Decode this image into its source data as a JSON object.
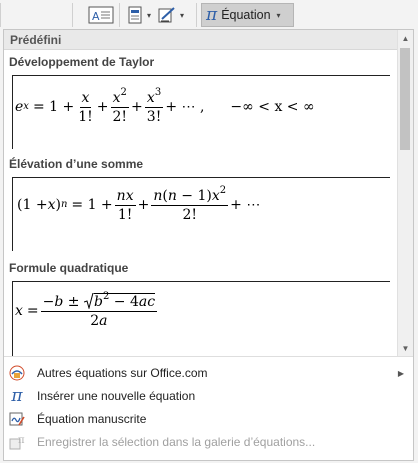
{
  "ribbon": {
    "equation_button": {
      "icon": "pi-icon",
      "label": "Équation"
    },
    "icons": [
      "text-box-icon",
      "quick-parts-icon",
      "signature-line-icon"
    ]
  },
  "gallery": {
    "category": "Prédéfini",
    "items": [
      {
        "title": "Développement de Taylor",
        "range": "−∞ < x < ∞"
      },
      {
        "title": "Élévation d’une somme"
      },
      {
        "title": "Formule quadratique"
      }
    ]
  },
  "menu": {
    "items": [
      {
        "label": "Autres équations sur Office.com",
        "icon": "office-equations-icon",
        "submenu": true,
        "enabled": true
      },
      {
        "label": "Insérer une nouvelle équation",
        "icon": "pi-icon",
        "enabled": true
      },
      {
        "label": "Équation manuscrite",
        "icon": "ink-equation-icon",
        "enabled": true
      },
      {
        "label": "Enregistrer la sélection dans la galerie d’équations...",
        "icon": "save-to-gallery-icon",
        "enabled": false
      }
    ]
  },
  "colors": {
    "accent": "#2e5fa8",
    "panel_bg": "#ffffff",
    "header_bg": "#e9e9e9",
    "disabled_text": "#a0a0a0"
  }
}
